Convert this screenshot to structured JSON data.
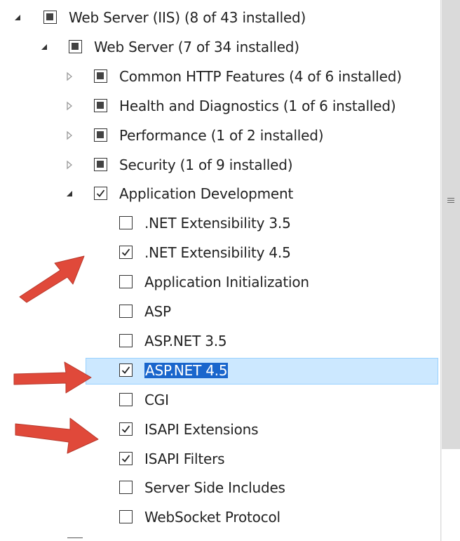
{
  "tree": [
    {
      "label": "Web Server (IIS) (8 of 43 installed)",
      "level": 0,
      "expander": "expanded",
      "check": "partial",
      "selected": false
    },
    {
      "label": "Web Server (7 of 34 installed)",
      "level": 1,
      "expander": "expanded",
      "check": "partial",
      "selected": false
    },
    {
      "label": "Common HTTP Features (4 of 6 installed)",
      "level": 2,
      "expander": "collapsed",
      "check": "partial",
      "selected": false
    },
    {
      "label": "Health and Diagnostics (1 of 6 installed)",
      "level": 2,
      "expander": "collapsed",
      "check": "partial",
      "selected": false
    },
    {
      "label": "Performance (1 of 2 installed)",
      "level": 2,
      "expander": "collapsed",
      "check": "partial",
      "selected": false
    },
    {
      "label": "Security (1 of 9 installed)",
      "level": 2,
      "expander": "collapsed",
      "check": "partial",
      "selected": false
    },
    {
      "label": "Application Development",
      "level": 2,
      "expander": "expanded",
      "check": "checked",
      "selected": false
    },
    {
      "label": ".NET Extensibility 3.5",
      "level": 3,
      "expander": "none",
      "check": "unchecked",
      "selected": false
    },
    {
      "label": ".NET Extensibility 4.5",
      "level": 3,
      "expander": "none",
      "check": "checked",
      "selected": false
    },
    {
      "label": "Application Initialization",
      "level": 3,
      "expander": "none",
      "check": "unchecked",
      "selected": false
    },
    {
      "label": "ASP",
      "level": 3,
      "expander": "none",
      "check": "unchecked",
      "selected": false
    },
    {
      "label": "ASP.NET 3.5",
      "level": 3,
      "expander": "none",
      "check": "unchecked",
      "selected": false
    },
    {
      "label": "ASP.NET 4.5",
      "level": 3,
      "expander": "none",
      "check": "checked",
      "selected": true
    },
    {
      "label": "CGI",
      "level": 3,
      "expander": "none",
      "check": "unchecked",
      "selected": false
    },
    {
      "label": "ISAPI Extensions",
      "level": 3,
      "expander": "none",
      "check": "checked",
      "selected": false
    },
    {
      "label": "ISAPI Filters",
      "level": 3,
      "expander": "none",
      "check": "checked",
      "selected": false
    },
    {
      "label": "Server Side Includes",
      "level": 3,
      "expander": "none",
      "check": "unchecked",
      "selected": false
    },
    {
      "label": "WebSocket Protocol",
      "level": 3,
      "expander": "none",
      "check": "unchecked",
      "selected": false
    }
  ],
  "annotation_arrows": [
    {
      "points_to": ".NET Extensibility 4.5",
      "color": "#e0493a"
    },
    {
      "points_to": "ASP.NET 4.5",
      "color": "#e0493a"
    },
    {
      "points_to": "ISAPI Extensions",
      "color": "#e0493a"
    }
  ],
  "colors": {
    "selection_fill": "#cce8ff",
    "selection_border": "#99d1ff",
    "text_highlight": "#1a66cc",
    "arrow": "#e0493a"
  }
}
